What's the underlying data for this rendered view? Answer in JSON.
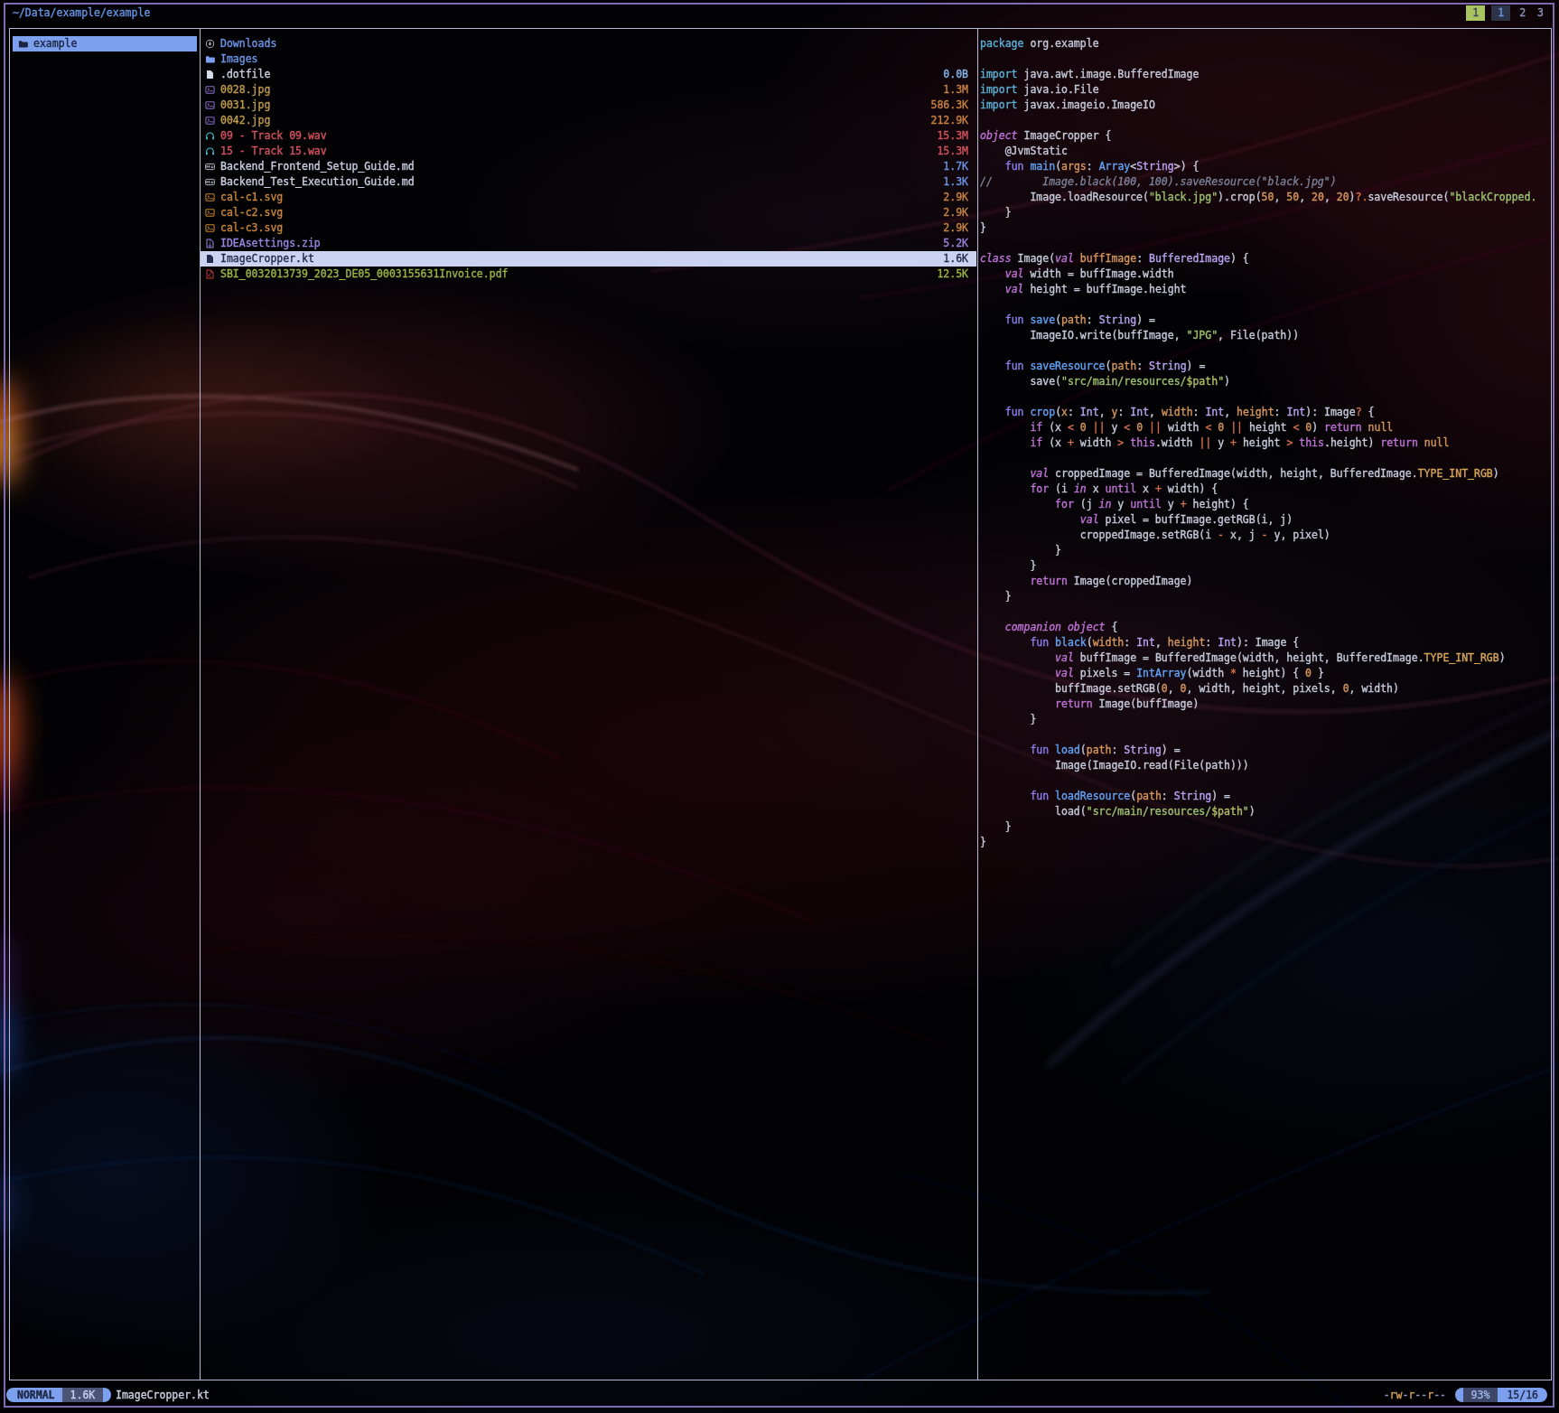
{
  "header": {
    "path": "~/Data/example/example"
  },
  "tabs": {
    "task_count": "1",
    "items": [
      {
        "label": "1",
        "active": true
      },
      {
        "label": "2",
        "active": false
      },
      {
        "label": "3",
        "active": false
      }
    ]
  },
  "parent_pane": {
    "items": [
      {
        "icon": "folder",
        "icon_color": "#1b2340",
        "name": "example",
        "selected": true
      }
    ]
  },
  "file_pane": {
    "items": [
      {
        "icon": "download",
        "icon_color": "#a9b2c8",
        "name": "Downloads",
        "name_class": "c-blue",
        "size": "",
        "size_class": "c-blue",
        "selected": false
      },
      {
        "icon": "folder",
        "icon_color": "#7d9ff0",
        "name": "Images",
        "name_class": "c-blue",
        "size": "",
        "size_class": "c-blue",
        "selected": false
      },
      {
        "icon": "file",
        "icon_color": "#d6dae8",
        "name": ".dotfile",
        "name_class": "c-white",
        "size": "0.0B",
        "size_class": "c-skyblue",
        "selected": false
      },
      {
        "icon": "image",
        "icon_color": "#8d6cc8",
        "name": "0028.jpg",
        "name_class": "c-jpg",
        "size": "1.3M",
        "size_class": "c-orange",
        "selected": false
      },
      {
        "icon": "image",
        "icon_color": "#8d6cc8",
        "name": "0031.jpg",
        "name_class": "c-jpg",
        "size": "586.3K",
        "size_class": "c-orange",
        "selected": false
      },
      {
        "icon": "image",
        "icon_color": "#8d6cc8",
        "name": "0042.jpg",
        "name_class": "c-jpg",
        "size": "212.9K",
        "size_class": "c-orange",
        "selected": false
      },
      {
        "icon": "headphones",
        "icon_color": "#3fc0cc",
        "name": "09 - Track 09.wav",
        "name_class": "c-red",
        "size": "15.3M",
        "size_class": "c-red",
        "selected": false
      },
      {
        "icon": "headphones",
        "icon_color": "#3fc0cc",
        "name": "15 - Track 15.wav",
        "name_class": "c-red",
        "size": "15.3M",
        "size_class": "c-red",
        "selected": false
      },
      {
        "icon": "markdown",
        "icon_color": "#c2c8da",
        "name": "Backend_Frontend_Setup_Guide.md",
        "name_class": "c-white",
        "size": "1.7K",
        "size_class": "c-blue",
        "selected": false
      },
      {
        "icon": "markdown",
        "icon_color": "#c2c8da",
        "name": "Backend_Test_Execution_Guide.md",
        "name_class": "c-white",
        "size": "1.3K",
        "size_class": "c-blue",
        "selected": false
      },
      {
        "icon": "image",
        "icon_color": "#c8862e",
        "name": "cal-c1.svg",
        "name_class": "c-svg",
        "size": "2.9K",
        "size_class": "c-orange",
        "selected": false
      },
      {
        "icon": "image",
        "icon_color": "#c8862e",
        "name": "cal-c2.svg",
        "name_class": "c-svg",
        "size": "2.9K",
        "size_class": "c-orange",
        "selected": false
      },
      {
        "icon": "image",
        "icon_color": "#c8862e",
        "name": "cal-c3.svg",
        "name_class": "c-svg",
        "size": "2.9K",
        "size_class": "c-orange",
        "selected": false
      },
      {
        "icon": "zip",
        "icon_color": "#9a86e0",
        "name": "IDEAsettings.zip",
        "name_class": "c-violet",
        "size": "5.2K",
        "size_class": "c-violet",
        "selected": false
      },
      {
        "icon": "file",
        "icon_color": "#232c4e",
        "name": "ImageCropper.kt",
        "name_class": "c-dark",
        "size": "1.6K",
        "size_class": "c-dark",
        "selected": true
      },
      {
        "icon": "pdf",
        "icon_color": "#c23b32",
        "name": "SBI_0032013739_2023_DE05_0003155631Invoice.pdf",
        "name_class": "c-green",
        "size": "12.5K",
        "size_class": "c-green",
        "selected": false
      }
    ]
  },
  "preview_pane": {
    "filename": "ImageCropper.kt",
    "lines": [
      [
        [
          "imp",
          "package"
        ],
        [
          "p",
          " org.example"
        ]
      ],
      [],
      [
        [
          "imp",
          "import"
        ],
        [
          "p",
          " java.awt.image.BufferedImage"
        ]
      ],
      [
        [
          "imp",
          "import"
        ],
        [
          "p",
          " java.io.File"
        ]
      ],
      [
        [
          "imp",
          "import"
        ],
        [
          "p",
          " javax.imageio.ImageIO"
        ]
      ],
      [],
      [
        [
          "kwi",
          "object"
        ],
        [
          "p",
          " ImageCropper {"
        ]
      ],
      [
        [
          "p",
          "    @JvmStatic"
        ]
      ],
      [
        [
          "p",
          "    "
        ],
        [
          "kwfun",
          "fun"
        ],
        [
          "p",
          " "
        ],
        [
          "fn",
          "main"
        ],
        [
          "p",
          "("
        ],
        [
          "param",
          "args"
        ],
        [
          "p",
          ": "
        ],
        [
          "typeb",
          "Array"
        ],
        [
          "p",
          "<"
        ],
        [
          "type",
          "String"
        ],
        [
          "p",
          ">) {"
        ]
      ],
      [
        [
          "com",
          "//        Image.black(100, 100).saveResource(\"black.jpg\")"
        ]
      ],
      [
        [
          "p",
          "        Image.loadResource("
        ],
        [
          "str",
          "\"black.jpg\""
        ],
        [
          "p",
          ").crop("
        ],
        [
          "num",
          "50"
        ],
        [
          "p",
          ", "
        ],
        [
          "num",
          "50"
        ],
        [
          "p",
          ", "
        ],
        [
          "num",
          "20"
        ],
        [
          "p",
          ", "
        ],
        [
          "num",
          "20"
        ],
        [
          "p",
          ")"
        ],
        [
          "op",
          "?."
        ],
        [
          "p",
          "saveResource("
        ],
        [
          "str",
          "\"blackCropped."
        ]
      ],
      [
        [
          "p",
          "    }"
        ]
      ],
      [
        [
          "p",
          "}"
        ]
      ],
      [],
      [
        [
          "kwi",
          "class"
        ],
        [
          "p",
          " Image("
        ],
        [
          "kwi",
          "val"
        ],
        [
          "p",
          " "
        ],
        [
          "param",
          "buffImage"
        ],
        [
          "p",
          ": "
        ],
        [
          "type",
          "BufferedImage"
        ],
        [
          "p",
          ") {"
        ]
      ],
      [
        [
          "p",
          "    "
        ],
        [
          "kwi",
          "val"
        ],
        [
          "p",
          " width = buffImage.width"
        ]
      ],
      [
        [
          "p",
          "    "
        ],
        [
          "kwi",
          "val"
        ],
        [
          "p",
          " height = buffImage.height"
        ]
      ],
      [],
      [
        [
          "p",
          "    "
        ],
        [
          "kwfun",
          "fun"
        ],
        [
          "p",
          " "
        ],
        [
          "fn",
          "save"
        ],
        [
          "p",
          "("
        ],
        [
          "param",
          "path"
        ],
        [
          "p",
          ": "
        ],
        [
          "type",
          "String"
        ],
        [
          "p",
          ") ="
        ]
      ],
      [
        [
          "p",
          "        ImageIO.write(buffImage, "
        ],
        [
          "str",
          "\"JPG\""
        ],
        [
          "p",
          ", File(path))"
        ]
      ],
      [],
      [
        [
          "p",
          "    "
        ],
        [
          "kwfun",
          "fun"
        ],
        [
          "p",
          " "
        ],
        [
          "fn",
          "saveResource"
        ],
        [
          "p",
          "("
        ],
        [
          "param",
          "path"
        ],
        [
          "p",
          ": "
        ],
        [
          "type",
          "String"
        ],
        [
          "p",
          ") ="
        ]
      ],
      [
        [
          "p",
          "        save("
        ],
        [
          "str",
          "\"src/main/resources/"
        ],
        [
          "interp",
          "$path"
        ],
        [
          "str",
          "\""
        ],
        [
          "p",
          ")"
        ]
      ],
      [],
      [
        [
          "p",
          "    "
        ],
        [
          "kwfun",
          "fun"
        ],
        [
          "p",
          " "
        ],
        [
          "fn",
          "crop"
        ],
        [
          "p",
          "("
        ],
        [
          "param",
          "x"
        ],
        [
          "p",
          ": "
        ],
        [
          "type",
          "Int"
        ],
        [
          "p",
          ", "
        ],
        [
          "param",
          "y"
        ],
        [
          "p",
          ": "
        ],
        [
          "type",
          "Int"
        ],
        [
          "p",
          ", "
        ],
        [
          "param",
          "width"
        ],
        [
          "p",
          ": "
        ],
        [
          "type",
          "Int"
        ],
        [
          "p",
          ", "
        ],
        [
          "param",
          "height"
        ],
        [
          "p",
          ": "
        ],
        [
          "type",
          "Int"
        ],
        [
          "p",
          "): Image"
        ],
        [
          "op",
          "?"
        ],
        [
          "p",
          " {"
        ]
      ],
      [
        [
          "p",
          "        "
        ],
        [
          "kw",
          "if"
        ],
        [
          "p",
          " (x "
        ],
        [
          "op",
          "<"
        ],
        [
          "p",
          " "
        ],
        [
          "num",
          "0"
        ],
        [
          "p",
          " "
        ],
        [
          "op",
          "||"
        ],
        [
          "p",
          " y "
        ],
        [
          "op",
          "<"
        ],
        [
          "p",
          " "
        ],
        [
          "num",
          "0"
        ],
        [
          "p",
          " "
        ],
        [
          "op",
          "||"
        ],
        [
          "p",
          " width "
        ],
        [
          "op",
          "<"
        ],
        [
          "p",
          " "
        ],
        [
          "num",
          "0"
        ],
        [
          "p",
          " "
        ],
        [
          "op",
          "||"
        ],
        [
          "p",
          " height "
        ],
        [
          "op",
          "<"
        ],
        [
          "p",
          " "
        ],
        [
          "num",
          "0"
        ],
        [
          "p",
          ") "
        ],
        [
          "kw",
          "return"
        ],
        [
          "p",
          " "
        ],
        [
          "num",
          "null"
        ]
      ],
      [
        [
          "p",
          "        "
        ],
        [
          "kw",
          "if"
        ],
        [
          "p",
          " (x "
        ],
        [
          "op",
          "+"
        ],
        [
          "p",
          " width "
        ],
        [
          "op",
          ">"
        ],
        [
          "p",
          " "
        ],
        [
          "kw",
          "this"
        ],
        [
          "p",
          ".width "
        ],
        [
          "op",
          "||"
        ],
        [
          "p",
          " y "
        ],
        [
          "op",
          "+"
        ],
        [
          "p",
          " height "
        ],
        [
          "op",
          ">"
        ],
        [
          "p",
          " "
        ],
        [
          "kw",
          "this"
        ],
        [
          "p",
          ".height) "
        ],
        [
          "kw",
          "return"
        ],
        [
          "p",
          " "
        ],
        [
          "num",
          "null"
        ]
      ],
      [],
      [
        [
          "p",
          "        "
        ],
        [
          "kwi",
          "val"
        ],
        [
          "p",
          " croppedImage = BufferedImage(width, height, BufferedImage."
        ],
        [
          "const",
          "TYPE_INT_RGB"
        ],
        [
          "p",
          ")"
        ]
      ],
      [
        [
          "p",
          "        "
        ],
        [
          "kw",
          "for"
        ],
        [
          "p",
          " (i "
        ],
        [
          "kwi",
          "in"
        ],
        [
          "p",
          " x "
        ],
        [
          "kw",
          "until"
        ],
        [
          "p",
          " x "
        ],
        [
          "op",
          "+"
        ],
        [
          "p",
          " width) {"
        ]
      ],
      [
        [
          "p",
          "            "
        ],
        [
          "kw",
          "for"
        ],
        [
          "p",
          " (j "
        ],
        [
          "kwi",
          "in"
        ],
        [
          "p",
          " y "
        ],
        [
          "kw",
          "until"
        ],
        [
          "p",
          " y "
        ],
        [
          "op",
          "+"
        ],
        [
          "p",
          " height) {"
        ]
      ],
      [
        [
          "p",
          "                "
        ],
        [
          "kwi",
          "val"
        ],
        [
          "p",
          " pixel = buffImage.getRGB(i, j)"
        ]
      ],
      [
        [
          "p",
          "                croppedImage.setRGB(i "
        ],
        [
          "op",
          "-"
        ],
        [
          "p",
          " x, j "
        ],
        [
          "op",
          "-"
        ],
        [
          "p",
          " y, pixel)"
        ]
      ],
      [
        [
          "p",
          "            }"
        ]
      ],
      [
        [
          "p",
          "        }"
        ]
      ],
      [
        [
          "p",
          "        "
        ],
        [
          "kw",
          "return"
        ],
        [
          "p",
          " Image(croppedImage)"
        ]
      ],
      [
        [
          "p",
          "    }"
        ]
      ],
      [],
      [
        [
          "p",
          "    "
        ],
        [
          "kwi",
          "companion object"
        ],
        [
          "p",
          " {"
        ]
      ],
      [
        [
          "p",
          "        "
        ],
        [
          "kwfun",
          "fun"
        ],
        [
          "p",
          " "
        ],
        [
          "fn",
          "black"
        ],
        [
          "p",
          "("
        ],
        [
          "param",
          "width"
        ],
        [
          "p",
          ": "
        ],
        [
          "type",
          "Int"
        ],
        [
          "p",
          ", "
        ],
        [
          "param",
          "height"
        ],
        [
          "p",
          ": "
        ],
        [
          "type",
          "Int"
        ],
        [
          "p",
          "): Image {"
        ]
      ],
      [
        [
          "p",
          "            "
        ],
        [
          "kwi",
          "val"
        ],
        [
          "p",
          " buffImage = BufferedImage(width, height, BufferedImage."
        ],
        [
          "const",
          "TYPE_INT_RGB"
        ],
        [
          "p",
          ")"
        ]
      ],
      [
        [
          "p",
          "            "
        ],
        [
          "kwi",
          "val"
        ],
        [
          "p",
          " pixels = "
        ],
        [
          "typeb",
          "IntArray"
        ],
        [
          "p",
          "(width "
        ],
        [
          "op",
          "*"
        ],
        [
          "p",
          " height) { "
        ],
        [
          "num",
          "0"
        ],
        [
          "p",
          " }"
        ]
      ],
      [
        [
          "p",
          "            buffImage.setRGB("
        ],
        [
          "num",
          "0"
        ],
        [
          "p",
          ", "
        ],
        [
          "num",
          "0"
        ],
        [
          "p",
          ", width, height, pixels, "
        ],
        [
          "num",
          "0"
        ],
        [
          "p",
          ", width)"
        ]
      ],
      [
        [
          "p",
          "            "
        ],
        [
          "kw",
          "return"
        ],
        [
          "p",
          " Image(buffImage)"
        ]
      ],
      [
        [
          "p",
          "        }"
        ]
      ],
      [],
      [
        [
          "p",
          "        "
        ],
        [
          "kwfun",
          "fun"
        ],
        [
          "p",
          " "
        ],
        [
          "fn",
          "load"
        ],
        [
          "p",
          "("
        ],
        [
          "param",
          "path"
        ],
        [
          "p",
          ": "
        ],
        [
          "type",
          "String"
        ],
        [
          "p",
          ") ="
        ]
      ],
      [
        [
          "p",
          "            Image(ImageIO.read(File(path)))"
        ]
      ],
      [],
      [
        [
          "p",
          "        "
        ],
        [
          "kwfun",
          "fun"
        ],
        [
          "p",
          " "
        ],
        [
          "fn",
          "loadResource"
        ],
        [
          "p",
          "("
        ],
        [
          "param",
          "path"
        ],
        [
          "p",
          ": "
        ],
        [
          "type",
          "String"
        ],
        [
          "p",
          ") ="
        ]
      ],
      [
        [
          "p",
          "            load("
        ],
        [
          "str",
          "\"src/main/resources/"
        ],
        [
          "interp",
          "$path"
        ],
        [
          "str",
          "\""
        ],
        [
          "p",
          ")"
        ]
      ],
      [
        [
          "p",
          "    }"
        ]
      ],
      [
        [
          "p",
          "}"
        ]
      ]
    ]
  },
  "status_bar": {
    "mode": "NORMAL",
    "file_size": "1.6K",
    "filename": "ImageCropper.kt",
    "permissions": "-rw-r--r--",
    "percent": "93%",
    "position": "15/16"
  }
}
